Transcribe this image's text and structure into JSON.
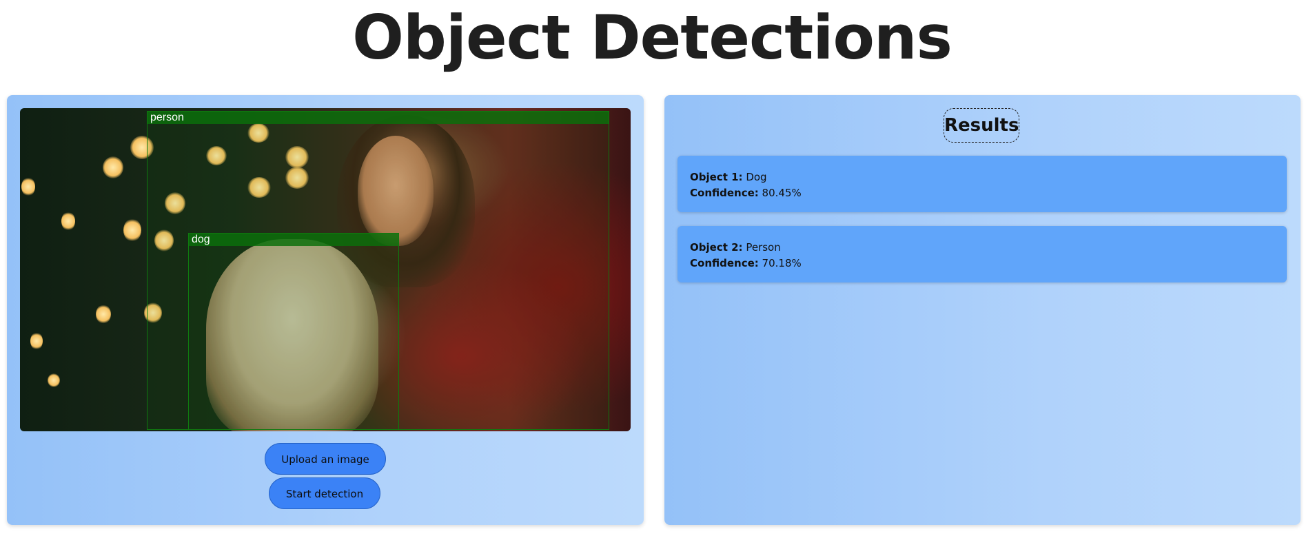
{
  "page": {
    "title": "Object Detections"
  },
  "detection": {
    "image_alt": "Woman holding a dog in front of a Christmas tree",
    "boxes": [
      {
        "label": "person"
      },
      {
        "label": "dog"
      }
    ],
    "upload_label": "Upload an image",
    "start_label": "Start detection",
    "box_color": "#0f7a0f",
    "button_color": "#3b82f6"
  },
  "results": {
    "heading": "Results",
    "object_key_1": "Object 1:",
    "confidence_key": "Confidence:",
    "items": [
      {
        "object_key": "Object 1:",
        "object": "Dog",
        "confidence": "80.45%"
      },
      {
        "object_key": "Object 2:",
        "object": "Person",
        "confidence": "70.18%"
      }
    ],
    "card_color": "#60a5fa"
  }
}
